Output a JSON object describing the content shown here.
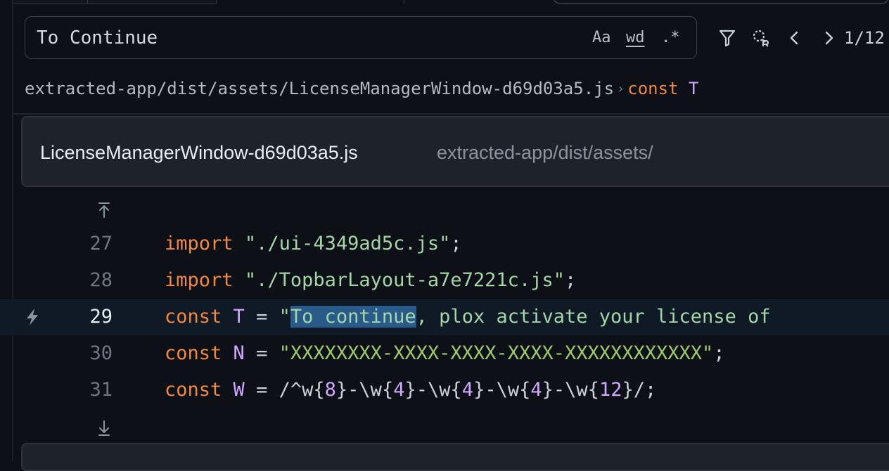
{
  "search": {
    "query": "To Continue",
    "placeholder": "",
    "match_case_label": "Aa",
    "whole_word_label": "wd",
    "regex_label": ".*",
    "match_count": "1/12"
  },
  "breadcrumb": {
    "path": "extracted-app/dist/assets/LicenseManagerWindow-d69d03a5.js",
    "separator": "›",
    "symbol_kind": "const",
    "symbol_name": "T"
  },
  "file": {
    "name": "LicenseManagerWindow-d69d03a5.js",
    "directory": "extracted-app/dist/assets/"
  },
  "code": {
    "lines": [
      {
        "number": "27",
        "keyword": "import",
        "string": "\"./ui-4349ad5c.js\"",
        "end": ";"
      },
      {
        "number": "28",
        "keyword": "import",
        "string": "\"./TopbarLayout-a7e7221c.js\"",
        "end": ";"
      },
      {
        "number": "29",
        "keyword": "const",
        "name": "T",
        "eq": " = ",
        "quote": "\"",
        "match": "To continue",
        "rest": ", plox activate your license of"
      },
      {
        "number": "30",
        "keyword": "const",
        "name": "N",
        "eq": " = ",
        "string": "\"XXXXXXXX-XXXX-XXXX-XXXX-XXXXXXXXXXXX\"",
        "end": ";"
      },
      {
        "number": "31",
        "keyword": "const",
        "name": "W",
        "eq": " = ",
        "regex": [
          {
            "t": "/^",
            "c": "punc"
          },
          {
            "t": "w",
            "c": "punc"
          },
          {
            "t": "{",
            "c": "punc"
          },
          {
            "t": "8",
            "c": "num"
          },
          {
            "t": "}",
            "c": "punc"
          },
          {
            "t": "-\\w",
            "c": "punc"
          },
          {
            "t": "{",
            "c": "punc"
          },
          {
            "t": "4",
            "c": "num"
          },
          {
            "t": "}",
            "c": "punc"
          },
          {
            "t": "-\\w",
            "c": "punc"
          },
          {
            "t": "{",
            "c": "punc"
          },
          {
            "t": "4",
            "c": "num"
          },
          {
            "t": "}",
            "c": "punc"
          },
          {
            "t": "-\\w",
            "c": "punc"
          },
          {
            "t": "{",
            "c": "punc"
          },
          {
            "t": "4",
            "c": "num"
          },
          {
            "t": "}",
            "c": "punc"
          },
          {
            "t": "-\\w",
            "c": "punc"
          },
          {
            "t": "{",
            "c": "punc"
          },
          {
            "t": "12",
            "c": "num"
          },
          {
            "t": "}",
            "c": "punc"
          },
          {
            "t": "/",
            "c": "punc"
          },
          {
            "t": ";",
            "c": "punc"
          }
        ]
      }
    ]
  },
  "icons": {
    "filter": "filter-icon",
    "replace": "replace-icon",
    "prev": "chevron-left-icon",
    "next": "chevron-right-icon",
    "expand_up": "expand-up-icon",
    "expand_down": "expand-down-icon",
    "gutter": "lightning-icon"
  },
  "colors": {
    "background": "#0d1117",
    "keyword": "#f0883e",
    "string": "#a5d6a7",
    "identifier": "#d2a8ff",
    "match_highlight": "#2a5a8a",
    "active_line": "#0f1a26"
  }
}
